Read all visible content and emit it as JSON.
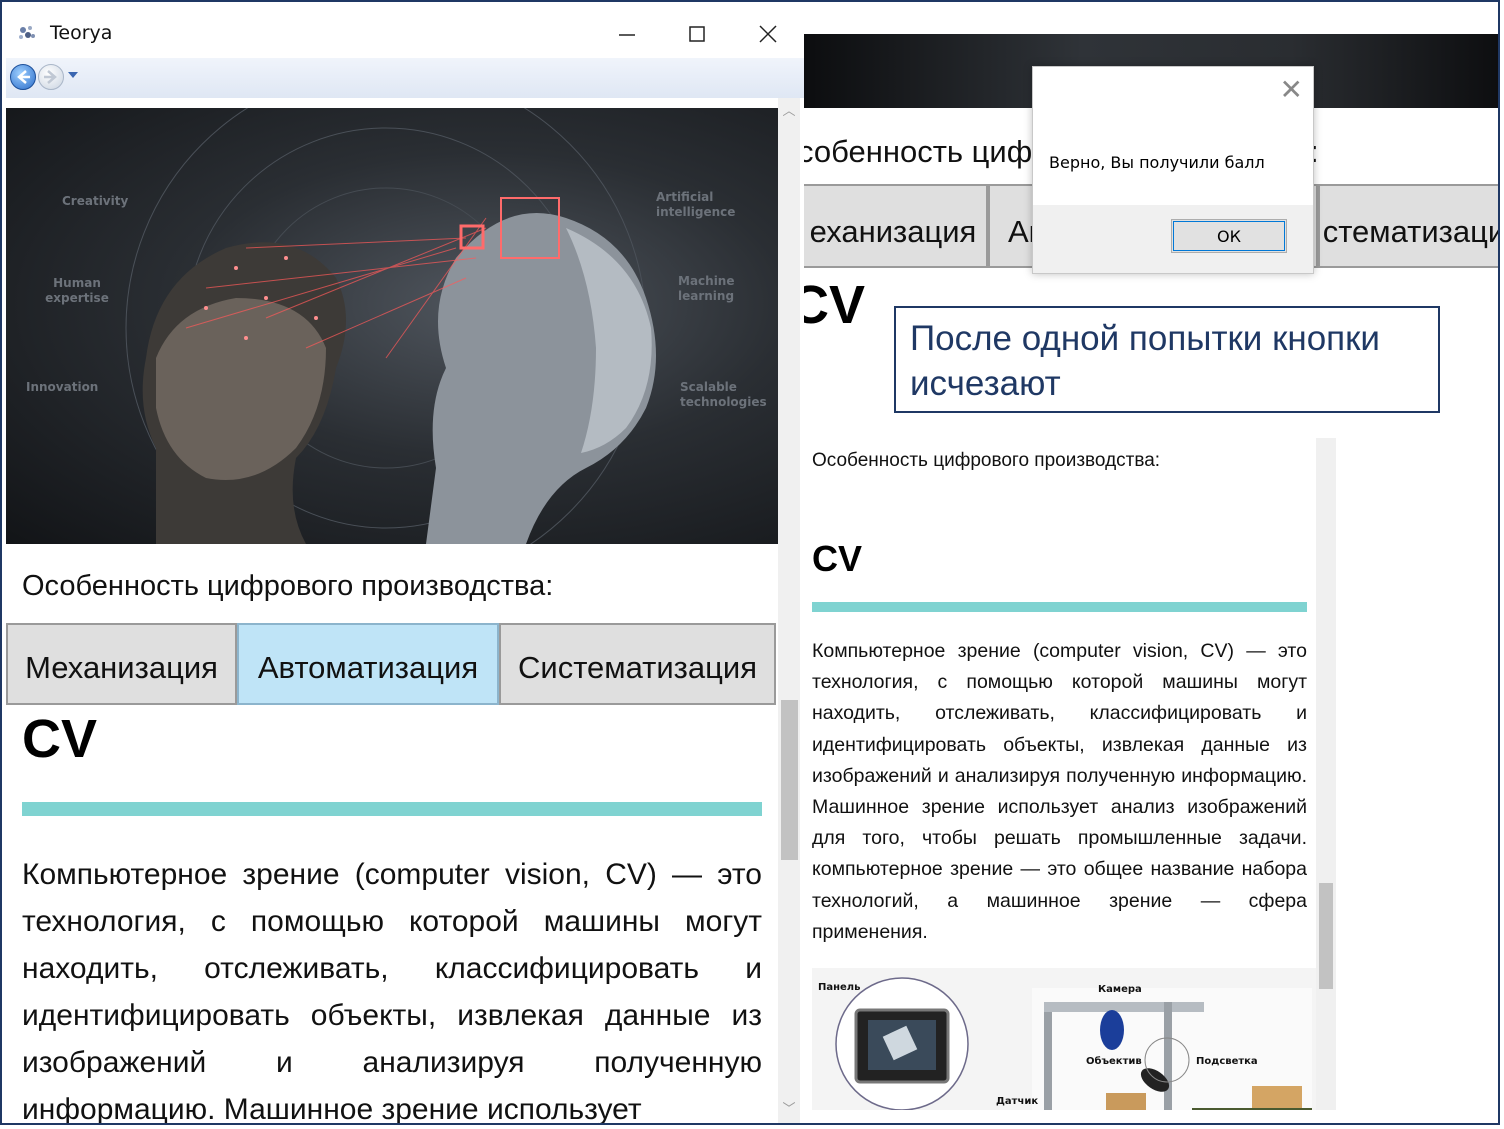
{
  "window": {
    "title": "Teorya",
    "minimize_icon": "minimize-icon",
    "maximize_icon": "maximize-icon",
    "close_icon": "close-icon"
  },
  "hero": {
    "labels": [
      "Creativity",
      "Artificial intelligence",
      "Human expertise",
      "Machine learning",
      "Innovation",
      "Scalable technologies"
    ]
  },
  "question": {
    "label": "Особенность цифрового производства:"
  },
  "answers": [
    "Механизация",
    "Автоматизация",
    "Систематизация"
  ],
  "right_answers_partial": [
    "еханизация",
    "Ав",
    "стематизация"
  ],
  "right_question_partial": "собенность циф",
  "right_question_colon": ":",
  "section": {
    "heading": "CV",
    "accent_color": "#7fd3d1",
    "text": "Компьютерное зрение (computer vision, CV) — это технология, с помощью которой машины могут находить, отслеживать, классифицировать и идентифицировать объекты, извлекая данные из изображений и анализируя полученную информацию. Машинное зрение использует анализ изображений для того, чтобы решать промышленные задачи. компьютерное зрение — это общее название набора технологий, а машинное зрение — сфера применения."
  },
  "left_para_visible": "Компьютерное зрение (computer vision, CV) — это технология, с помощью которой машины могут находить, отслеживать, классифицировать и идентифицировать объекты, извлекая данные из изображений и анализируя полученную информацию. Машинное зрение использует",
  "dialog": {
    "message": "Верно, Вы получили балл",
    "ok_label": "ОК"
  },
  "callout": {
    "text": "После одной попытки кнопки исчезают"
  },
  "diagram_labels": {
    "panel": "Панель",
    "camera": "Камера",
    "lens": "Объектив",
    "light": "Подсветка",
    "sensor": "Датчик"
  },
  "colors": {
    "active_tab": "#bfe4f7",
    "tab": "#dfdfdf",
    "callout_border": "#1f3864"
  }
}
